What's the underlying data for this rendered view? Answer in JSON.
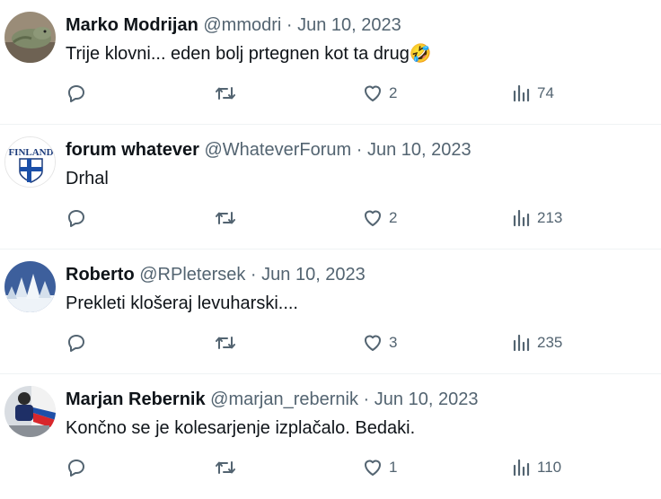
{
  "tweets": [
    {
      "name": "Marko Modrijan",
      "handle": "@mmodri",
      "date": "Jun 10, 2023",
      "text": "Trije klovni... eden bolj prtegnen kot ta drug🤣",
      "likes": "2",
      "views": "74",
      "avatar": "lizard-avatar"
    },
    {
      "name": "forum whatever",
      "handle": "@WhateverForum",
      "date": "Jun 10, 2023",
      "text": "Drhal",
      "likes": "2",
      "views": "213",
      "avatar": "finland-flag-avatar",
      "avatar_text": "FINLAND"
    },
    {
      "name": "Roberto",
      "handle": "@RPletersek",
      "date": "Jun 10, 2023",
      "text": "Prekleti klošeraj levuharski....",
      "likes": "3",
      "views": "235",
      "avatar": "snowy-trees-avatar"
    },
    {
      "name": "Marjan Rebernik",
      "handle": "@marjan_rebernik",
      "date": "Jun 10, 2023",
      "text": "Končno se je kolesarjenje izplačalo. Bedaki.",
      "likes": "1",
      "views": "110",
      "avatar": "cyclist-avatar"
    }
  ],
  "separator": " · ",
  "colors": {
    "text": "#0f1419",
    "secondary": "#536471",
    "divider": "#eff3f4"
  }
}
